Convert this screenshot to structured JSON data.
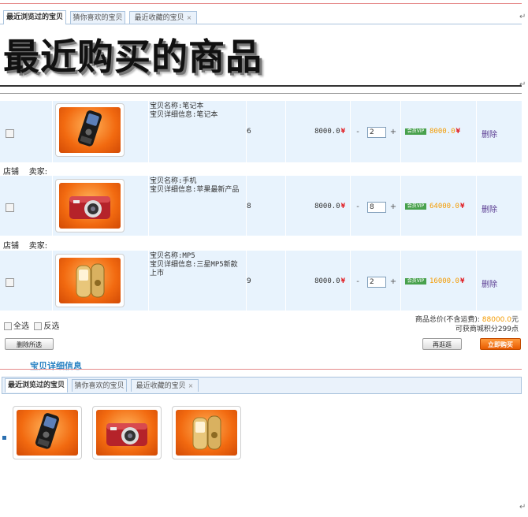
{
  "top_tabs": [
    {
      "label": "最近浏览过的宝贝",
      "active": true
    },
    {
      "label": "猜你喜欢的宝贝",
      "active": false
    },
    {
      "label": "最近收藏的宝贝",
      "active": false
    }
  ],
  "page_title": "最近购买的商品",
  "items": [
    {
      "name_line": "宝贝名称:笔记本",
      "detail_line": "宝贝详细信息:笔记本",
      "qty": "6",
      "price": "8000.0",
      "stepper": "2",
      "vip_price": "8000.0",
      "delete": "删除",
      "image": "phone-icon"
    },
    {
      "shop_label": "店铺",
      "seller_label": "卖家:",
      "name_line": "宝贝名称:手机",
      "detail_line": "宝贝详细信息:苹果最新产品",
      "qty": "8",
      "price": "8000.0",
      "stepper": "8",
      "vip_price": "64000.0",
      "delete": "删除",
      "image": "camera-icon"
    },
    {
      "shop_label": "店铺",
      "seller_label": "卖家:",
      "name_line": "宝贝名称:MP5",
      "detail_line": "宝贝详细信息:三星MP5新款上市",
      "qty": "9",
      "price": "8000.0",
      "stepper": "2",
      "vip_price": "16000.0",
      "delete": "删除",
      "image": "mp5-icon"
    }
  ],
  "currency": "¥",
  "vip_badge": "会员VIP",
  "footer": {
    "select_all": "全选",
    "invert": "反选",
    "total_label": "商品总价(不含运费):",
    "total_value": "88000.0",
    "total_unit": "元",
    "points": "可获商城积分299点",
    "delete_selected": "删除所选",
    "continue": "再逛逛",
    "buy": "立即购买"
  },
  "detail_heading": "宝贝详细信息",
  "bottom_tabs": [
    {
      "label": "最近浏览过的宝贝",
      "active": true
    },
    {
      "label": "猜你喜欢的宝贝",
      "active": false
    },
    {
      "label": "最近收藏的宝贝",
      "active": false
    }
  ],
  "colors": {
    "tab_border": "#aac3dd",
    "row_bg": "#e8f3fd",
    "price_red": "#e0161b",
    "vip_green": "#48a14d",
    "vip_price": "#f49b00",
    "buy_orange": "#e85b00"
  }
}
